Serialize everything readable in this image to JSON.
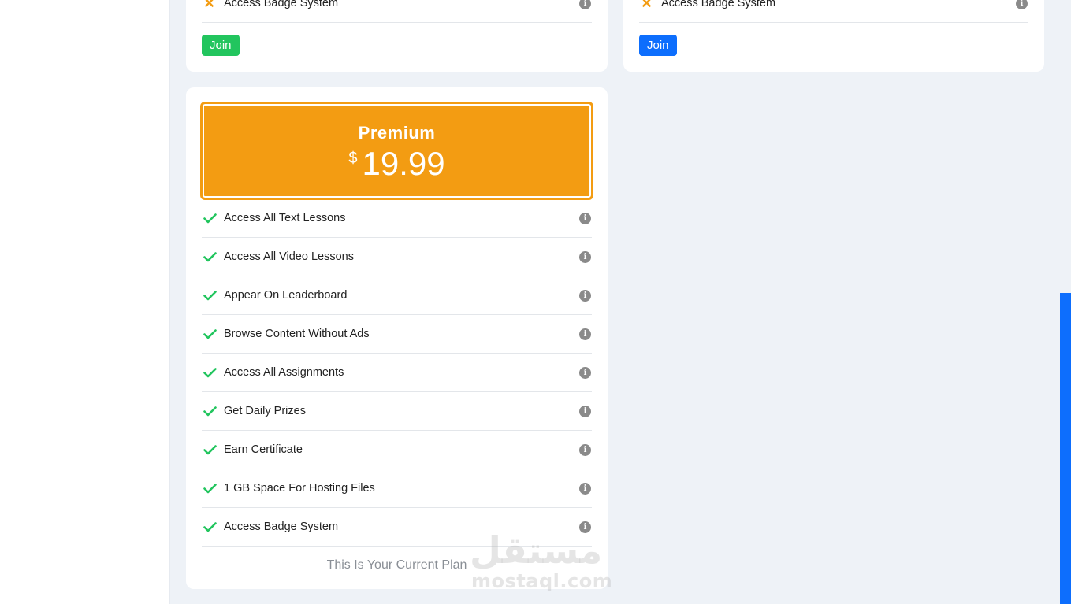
{
  "plans": {
    "free": {
      "last_feature": "Access Badge System",
      "join_label": "Join",
      "join_color": "#22c55e"
    },
    "standard": {
      "last_feature": "Access Badge System",
      "join_label": "Join",
      "join_color": "#0d6efd"
    },
    "premium": {
      "title": "Premium",
      "currency": "$",
      "price": "19.99",
      "header_color": "#f39c12",
      "features": [
        "Access All Text Lessons",
        "Access All Video Lessons",
        "Appear On Leaderboard",
        "Browse Content Without Ads",
        "Access All Assignments",
        "Get Daily Prizes",
        "Earn Certificate",
        "1 GB Space For Hosting Files",
        "Access Badge System"
      ],
      "current_plan_text": "This Is Your Current Plan"
    }
  },
  "icons": {
    "included": "check-icon",
    "excluded": "cross-icon",
    "info": "info-icon",
    "info_glyph": "i"
  },
  "watermark": {
    "arabic": "مستقل",
    "latin": "mostaql.com"
  },
  "colors": {
    "check": "#22c55e",
    "cross": "#f39c12",
    "scrollbar": "#0d6efd",
    "background": "#eef2f7"
  }
}
